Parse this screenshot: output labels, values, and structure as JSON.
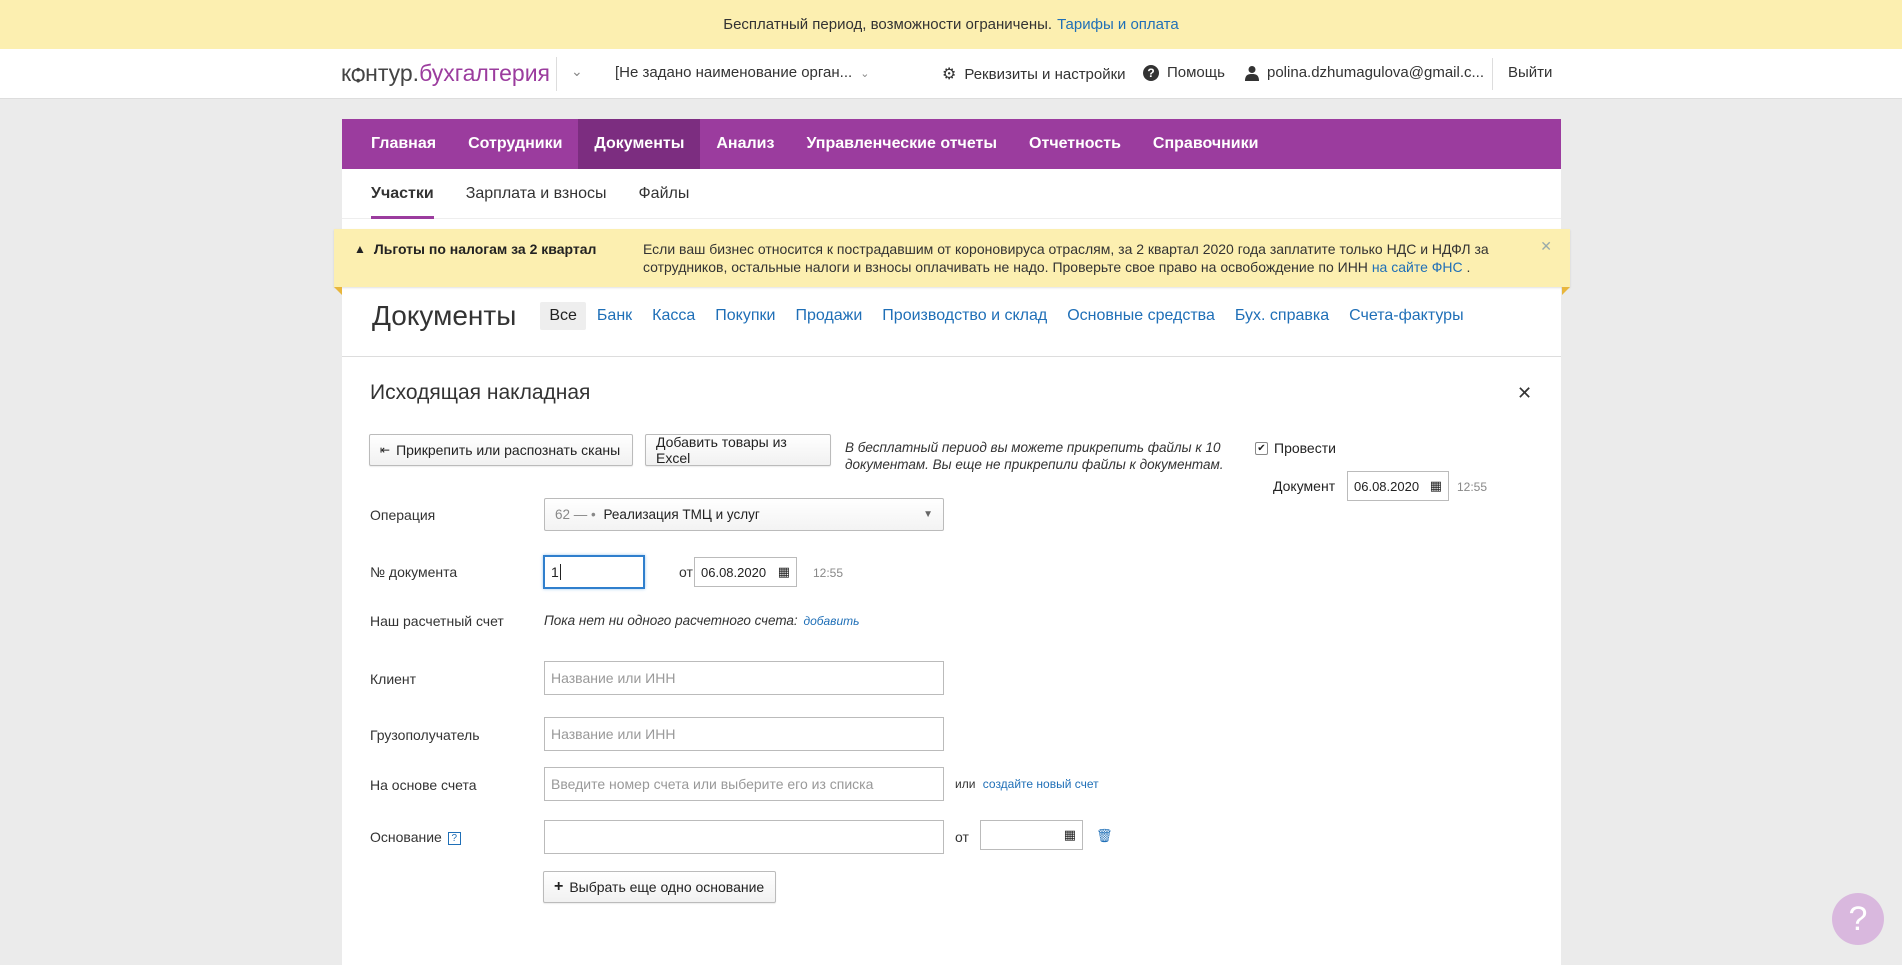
{
  "trial": {
    "text": "Бесплатный период, возможности ограничены.",
    "link": "Тарифы и оплата"
  },
  "topbar": {
    "logo_prefix": "кѻнтур.",
    "logo_accent": "бухгалтерия",
    "org_name": "[Не задано наименование орган...",
    "settings": "Реквизиты и настройки",
    "help": "Помощь",
    "user": "polina.dzhumagulova@gmail.c...",
    "logout": "Выйти"
  },
  "mainnav": [
    "Главная",
    "Сотрудники",
    "Документы",
    "Анализ",
    "Управленческие отчеты",
    "Отчетность",
    "Справочники"
  ],
  "subnav": [
    "Участки",
    "Зарплата и взносы",
    "Файлы"
  ],
  "alert": {
    "title": "Льготы по налогам за 2 квартал",
    "text": "Если ваш бизнес относится к пострадавшим от короновируса отраслям, за 2 квартал 2020 года заплатите только НДС и НДФЛ за сотрудников, остальные налоги и взносы оплачивать не надо. Проверьте свое право на освобождение по ИНН",
    "link": "на сайте ФНС",
    "tail": " ."
  },
  "docs": {
    "title": "Документы",
    "tabs": [
      "Все",
      "Банк",
      "Касса",
      "Покупки",
      "Продажи",
      "Производство и склад",
      "Основные средства",
      "Бух. справка",
      "Счета-фактуры"
    ]
  },
  "form": {
    "title": "Исходящая накладная",
    "attach_button": "Прикрепить или распознать сканы",
    "excel_button": "Добавить товары из Excel",
    "hint": "В бесплатный период вы можете прикрепить файлы к 10 документам. Вы еще не прикрепили файлы к документам.",
    "post_label": "Провести",
    "doc_label": "Документ",
    "doc_date": "06.08.2020",
    "doc_time": "12:55",
    "operation_label": "Операция",
    "operation_code": "62 — •",
    "operation_value": "Реализация ТМЦ и услуг",
    "docnum_label": "№ документа",
    "docnum_value": "1",
    "from_label": "от",
    "docnum_date": "06.08.2020",
    "docnum_time": "12:55",
    "account_label": "Наш расчетный счет",
    "account_note": "Пока нет ни одного расчетного счета:",
    "account_add": "добавить",
    "client_label": "Клиент",
    "client_placeholder": "Название или ИНН",
    "consignee_label": "Грузополучатель",
    "consignee_placeholder": "Название или ИНН",
    "invoice_label": "На основе счета",
    "invoice_placeholder": "Введите номер счета или выберите его из списка",
    "invoice_or": "или",
    "invoice_create": "создайте новый счет",
    "basis_label": "Основание",
    "basis_from": "от",
    "add_basis_button": "Выбрать еще одно основание"
  }
}
